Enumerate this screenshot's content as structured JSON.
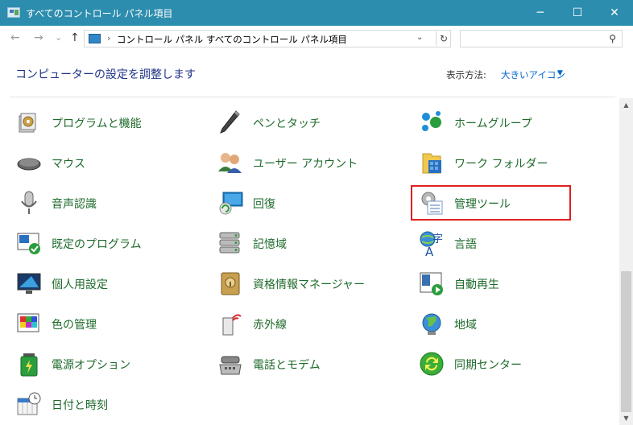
{
  "window": {
    "title": "すべてのコントロール パネル項目",
    "minimize": "─",
    "maximize": "☐",
    "close": "✕"
  },
  "nav": {
    "back": "←",
    "forward": "→",
    "recent": "⌄",
    "up": "↑"
  },
  "address": {
    "breadcrumb": [
      "コントロール パネル",
      "すべてのコントロール パネル項目"
    ],
    "separator": "›",
    "dropdown": "⌄",
    "refresh": "↻"
  },
  "search": {
    "placeholder": "",
    "icon": "⚲"
  },
  "header": {
    "heading": "コンピューターの設定を調整します",
    "view_by_label": "表示方法:",
    "view_by_value": "大きいアイコン",
    "view_by_arrow": "▼"
  },
  "items": [
    {
      "label": "プログラムと機能",
      "icon": "programs-features-icon"
    },
    {
      "label": "ペンとタッチ",
      "icon": "pen-touch-icon"
    },
    {
      "label": "ホームグループ",
      "icon": "homegroup-icon"
    },
    {
      "label": "マウス",
      "icon": "mouse-icon"
    },
    {
      "label": "ユーザー アカウント",
      "icon": "user-accounts-icon"
    },
    {
      "label": "ワーク フォルダー",
      "icon": "work-folders-icon"
    },
    {
      "label": "音声認識",
      "icon": "speech-recognition-icon"
    },
    {
      "label": "回復",
      "icon": "recovery-icon"
    },
    {
      "label": "管理ツール",
      "icon": "admin-tools-icon"
    },
    {
      "label": "既定のプログラム",
      "icon": "default-programs-icon"
    },
    {
      "label": "記憶域",
      "icon": "storage-spaces-icon"
    },
    {
      "label": "言語",
      "icon": "language-icon"
    },
    {
      "label": "個人用設定",
      "icon": "personalization-icon"
    },
    {
      "label": "資格情報マネージャー",
      "icon": "credential-manager-icon"
    },
    {
      "label": "自動再生",
      "icon": "autoplay-icon"
    },
    {
      "label": "色の管理",
      "icon": "color-management-icon"
    },
    {
      "label": "赤外線",
      "icon": "infrared-icon"
    },
    {
      "label": "地域",
      "icon": "region-icon"
    },
    {
      "label": "電源オプション",
      "icon": "power-options-icon"
    },
    {
      "label": "電話とモデム",
      "icon": "phone-modem-icon"
    },
    {
      "label": "同期センター",
      "icon": "sync-center-icon"
    },
    {
      "label": "日付と時刻",
      "icon": "date-time-icon"
    }
  ],
  "scrollbar": {
    "up": "▲",
    "down": "▼"
  },
  "colors": {
    "titlebar": "#2d8dae",
    "link_green": "#1e6a2b",
    "heading_blue": "#1e3287",
    "highlight_red": "#e02020"
  }
}
